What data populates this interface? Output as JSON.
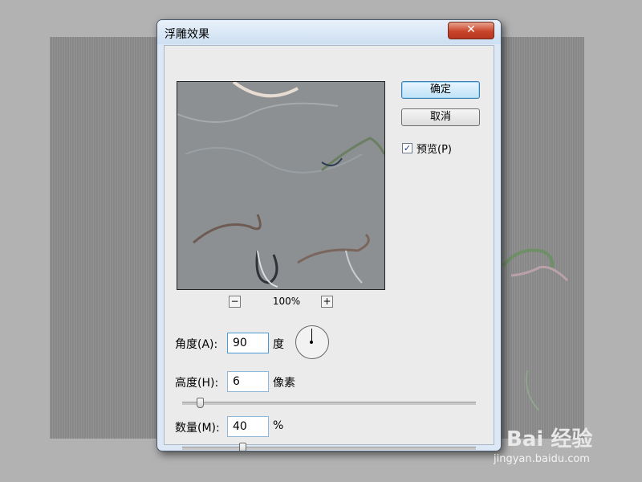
{
  "dialog": {
    "title": "浮雕效果",
    "close_glyph": "✕",
    "zoom": {
      "out_label": "−",
      "in_label": "+",
      "level": "100%"
    },
    "buttons": {
      "ok": "确定",
      "cancel": "取消"
    },
    "preview_checkbox": {
      "label": "预览(P)",
      "checked": true,
      "glyph": "✓"
    },
    "params": {
      "angle": {
        "label": "角度(A):",
        "value": "90",
        "unit": "度",
        "dial_degrees": 90
      },
      "height": {
        "label": "高度(H):",
        "value": "6",
        "unit": "像素",
        "slider_fraction": 0.05
      },
      "amount": {
        "label": "数量(M):",
        "value": "40",
        "unit": "%",
        "slider_fraction": 0.2
      }
    }
  },
  "watermark": {
    "brand": "Bai 经验",
    "url": "jingyan.baidu.com"
  },
  "colors": {
    "title_bar": "#dce8f5",
    "close_button": "#c9452a",
    "ok_button": "#bfe2f8",
    "canvas": "#8d8d8d"
  }
}
